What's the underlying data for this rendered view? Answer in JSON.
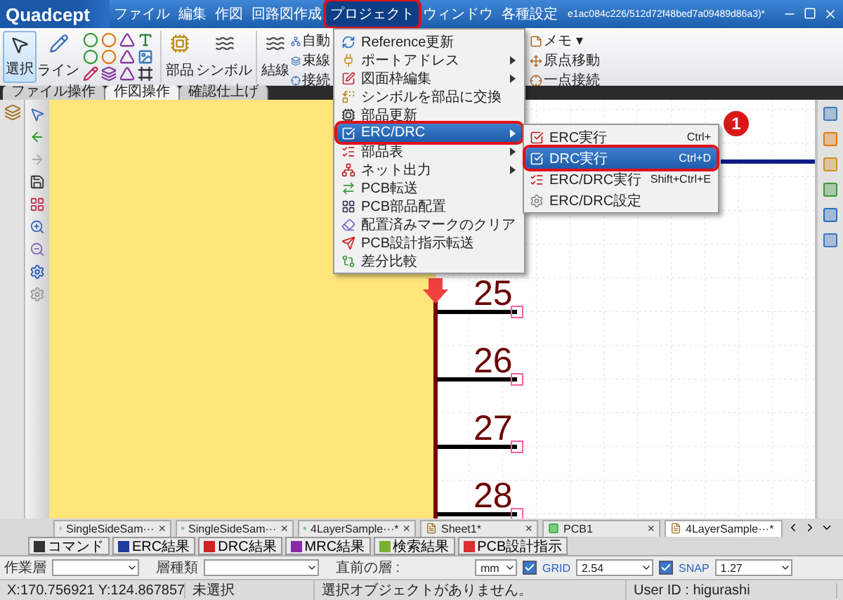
{
  "app": {
    "logo": "Quadcept",
    "title": "e1ac084c226/512d72f48bed7a09489d86a3)*"
  },
  "menu_bar": [
    {
      "label": "ファイル",
      "selected": false,
      "highlighted": false
    },
    {
      "label": "編集",
      "selected": false,
      "highlighted": false
    },
    {
      "label": "作図",
      "selected": false,
      "highlighted": false
    },
    {
      "label": "回路図作成",
      "selected": false,
      "highlighted": false
    },
    {
      "label": "プロジェクト",
      "selected": true,
      "highlighted": true
    },
    {
      "label": "ウィンドウ",
      "selected": false,
      "highlighted": false
    },
    {
      "label": "各種設定",
      "selected": false,
      "highlighted": false
    }
  ],
  "ribbon": {
    "large_buttons": [
      {
        "label": "選択",
        "selected": true
      },
      {
        "label": "ライン",
        "selected": false
      }
    ],
    "part_buttons": [
      {
        "label": "部品"
      },
      {
        "label": "シンボル"
      },
      {
        "label": "結線"
      }
    ],
    "wire_list": [
      {
        "label": "自動"
      },
      {
        "label": "束線"
      },
      {
        "label": "接続"
      }
    ],
    "edit_list": [
      {
        "label": "メモ ▾"
      },
      {
        "label": "原点移動"
      },
      {
        "label": "一点接続"
      }
    ]
  },
  "ribbon_tabs": [
    {
      "label": "ファイル操作",
      "selected": false
    },
    {
      "label": "作図操作",
      "selected": true
    },
    {
      "label": "確認仕上げ",
      "selected": false
    }
  ],
  "canvas": {
    "pins": [
      {
        "number": "25"
      },
      {
        "number": "26"
      },
      {
        "number": "27"
      },
      {
        "number": "28"
      }
    ]
  },
  "project_menu": [
    {
      "label": "Reference更新",
      "submenu": false,
      "selected": false,
      "highlighted": false
    },
    {
      "label": "ポートアドレス",
      "submenu": true,
      "selected": false,
      "highlighted": false
    },
    {
      "label": "図面枠編集",
      "submenu": true,
      "selected": false,
      "highlighted": false
    },
    {
      "label": "シンボルを部品に交換",
      "submenu": false,
      "selected": false,
      "highlighted": false
    },
    {
      "label": "部品更新",
      "submenu": false,
      "selected": false,
      "highlighted": false
    },
    {
      "label": "ERC/DRC",
      "submenu": true,
      "selected": true,
      "highlighted": true
    },
    {
      "label": "部品表",
      "submenu": true,
      "selected": false,
      "highlighted": false
    },
    {
      "label": "ネット出力",
      "submenu": true,
      "selected": false,
      "highlighted": false
    },
    {
      "label": "PCB転送",
      "submenu": false,
      "selected": false,
      "highlighted": false
    },
    {
      "label": "PCB部品配置",
      "submenu": false,
      "selected": false,
      "highlighted": false
    },
    {
      "label": "配置済みマークのクリア",
      "submenu": false,
      "selected": false,
      "highlighted": false
    },
    {
      "label": "PCB設計指示転送",
      "submenu": false,
      "selected": false,
      "highlighted": false
    },
    {
      "label": "差分比較",
      "submenu": false,
      "selected": false,
      "highlighted": false
    }
  ],
  "erc_submenu": [
    {
      "label": "ERC実行",
      "shortcut": "Ctrl+",
      "selected": false,
      "highlighted": false
    },
    {
      "label": "DRC実行",
      "shortcut": "Ctrl+D",
      "selected": true,
      "highlighted": true
    },
    {
      "label": "ERC/DRC実行",
      "shortcut": "Shift+Ctrl+E",
      "selected": false,
      "highlighted": false
    },
    {
      "label": "ERC/DRC設定",
      "selected": false,
      "highlighted": false
    }
  ],
  "callout": {
    "number": "1"
  },
  "doc_tabs": [
    {
      "label": "SingleSideSam···",
      "kind": "sch",
      "close": "×",
      "selected": false
    },
    {
      "label": "SingleSideSam···",
      "kind": "pcb",
      "close": "×",
      "selected": false
    },
    {
      "label": "4LayerSample···*",
      "kind": "pcb",
      "close": "×",
      "selected": false
    },
    {
      "label": "Sheet1*",
      "kind": "sch",
      "close": "×",
      "selected": false
    },
    {
      "label": "PCB1",
      "kind": "pcb",
      "close": "×",
      "selected": false
    },
    {
      "label": "4LayerSample···*",
      "kind": "sch",
      "selected": true
    }
  ],
  "result_tabs": [
    {
      "label": "コマンド",
      "color": "#333333"
    },
    {
      "label": "ERC結果",
      "color": "#1f3c9c"
    },
    {
      "label": "DRC結果",
      "color": "#d42020"
    },
    {
      "label": "MRC結果",
      "color": "#8a2aa8"
    },
    {
      "label": "検索結果",
      "color": "#7ab030"
    },
    {
      "label": "PCB設計指示",
      "color": "#d83030"
    }
  ],
  "properties": {
    "work_layer": {
      "label": "作業層"
    },
    "layer_type": {
      "label": "層種類"
    },
    "prev_layer": {
      "label": "直前の層 :"
    },
    "unit": {
      "value": "mm"
    },
    "grid": {
      "label": "GRID",
      "checked": true,
      "value": "2.54"
    },
    "snap": {
      "label": "SNAP",
      "checked": true,
      "value": "1.27"
    }
  },
  "status_bar": [
    "X:170.756921 Y:124.867857",
    "未選択",
    "選択オブジェクトがありません。",
    "User ID : higurashi"
  ]
}
